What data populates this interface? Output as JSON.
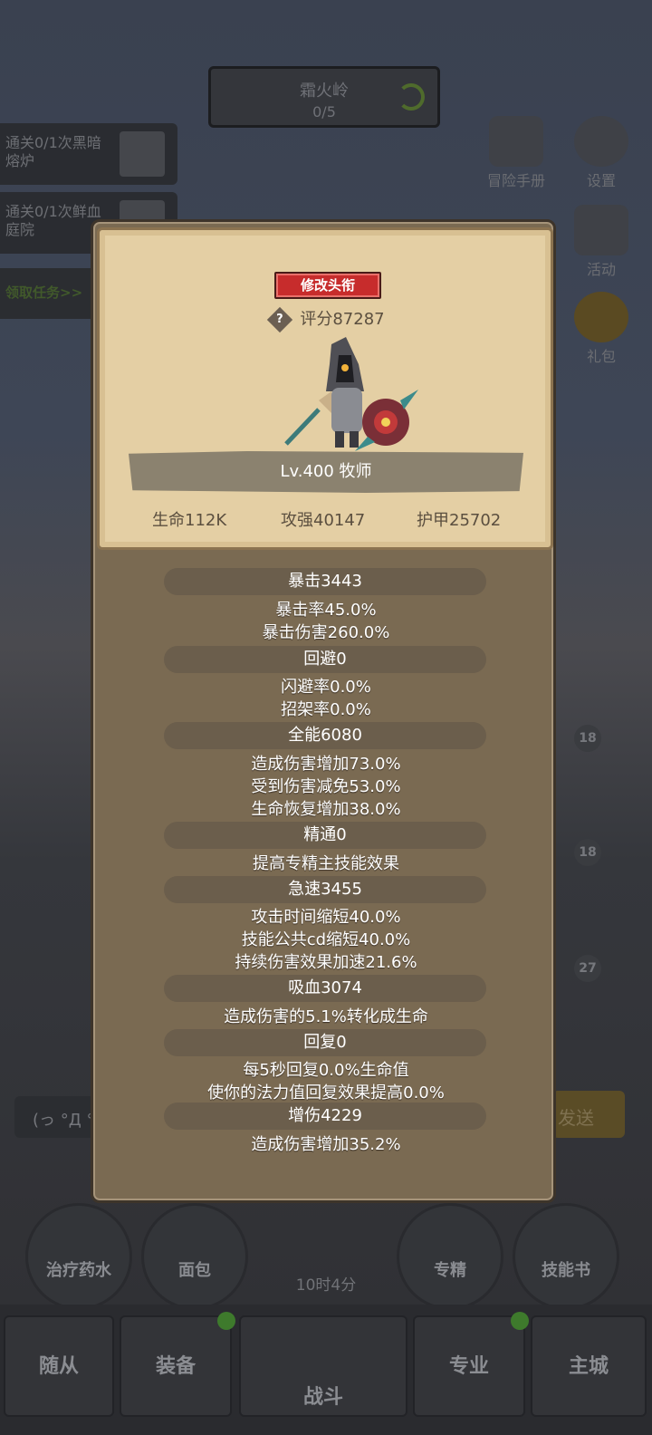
{
  "background": {
    "stage": {
      "name": "霜火岭",
      "progress": "0/5"
    },
    "quests": [
      {
        "text": "通关0/1次黑暗熔炉"
      },
      {
        "text": "通关0/1次鲜血庭院"
      }
    ],
    "quest_claim": "领取任务>>",
    "side_icons": {
      "adventure": "冒险手册",
      "settings": "设置",
      "activity": "活动",
      "gift": "礼包"
    },
    "slot_badges": [
      "18",
      "18",
      "27"
    ],
    "chat_text": "(っ °Д °",
    "send_label": "发送",
    "items": {
      "potion": "治疗药水",
      "bread": "面包",
      "spec": "专精",
      "skillbook": "技能书"
    },
    "timer": "10时4分",
    "nav": {
      "followers": "随从",
      "equipment": "装备",
      "battle": "战斗",
      "profession": "专业",
      "city": "主城"
    }
  },
  "profile": {
    "rename_label": "修改头衔",
    "help_icon": "?",
    "score": "评分87287",
    "level_class": "Lv.400 牧师",
    "hp": "生命112K",
    "attack": "攻强40147",
    "armor": "护甲25702"
  },
  "stats": [
    {
      "header": "暴击3443",
      "lines": [
        "暴击率45.0%",
        "暴击伤害260.0%"
      ]
    },
    {
      "header": "回避0",
      "lines": [
        "闪避率0.0%",
        "招架率0.0%"
      ]
    },
    {
      "header": "全能6080",
      "lines": [
        "造成伤害增加73.0%",
        "受到伤害减免53.0%",
        "生命恢复增加38.0%"
      ]
    },
    {
      "header": "精通0",
      "lines": [
        "提高专精主技能效果"
      ]
    },
    {
      "header": "急速3455",
      "lines": [
        "攻击时间缩短40.0%",
        "技能公共cd缩短40.0%",
        "持续伤害效果加速21.6%"
      ]
    },
    {
      "header": "吸血3074",
      "lines": [
        "造成伤害的5.1%转化成生命"
      ]
    },
    {
      "header": "回复0",
      "lines": [
        "每5秒回复0.0%生命值",
        "使你的法力值回复效果提高0.0%"
      ]
    },
    {
      "header": "增伤4229",
      "lines": [
        "造成伤害增加35.2%"
      ]
    }
  ]
}
